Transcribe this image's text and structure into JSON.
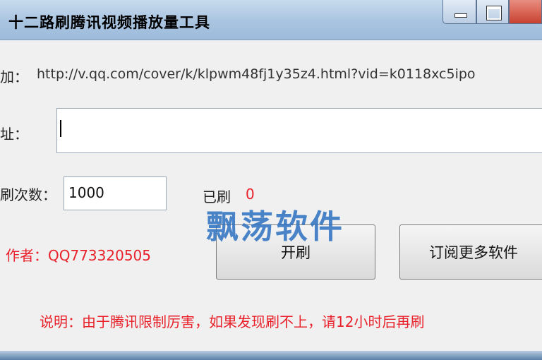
{
  "window": {
    "title": "十二路刷腾讯视频播放量工具"
  },
  "form": {
    "example_label": "加：",
    "example_url": "http://v.qq.com/cover/k/klpwm48fj1y35z4.html?vid=k0118xc5ipo",
    "url_label": "址：",
    "url_value": "",
    "count_label": "刷次数：",
    "count_value": "1000",
    "done_label": "已刷",
    "done_value": "0",
    "author": "作者：QQ773320505"
  },
  "buttons": {
    "start": "开刷",
    "subscribe": "订阅更多软件"
  },
  "note": "说明：由于腾讯限制厉害，如果发现刷不上，请12小时后再刷",
  "watermark": "飘荡软件",
  "colors": {
    "accent_red": "#e8212a",
    "watermark_blue": "#2d70c0"
  }
}
